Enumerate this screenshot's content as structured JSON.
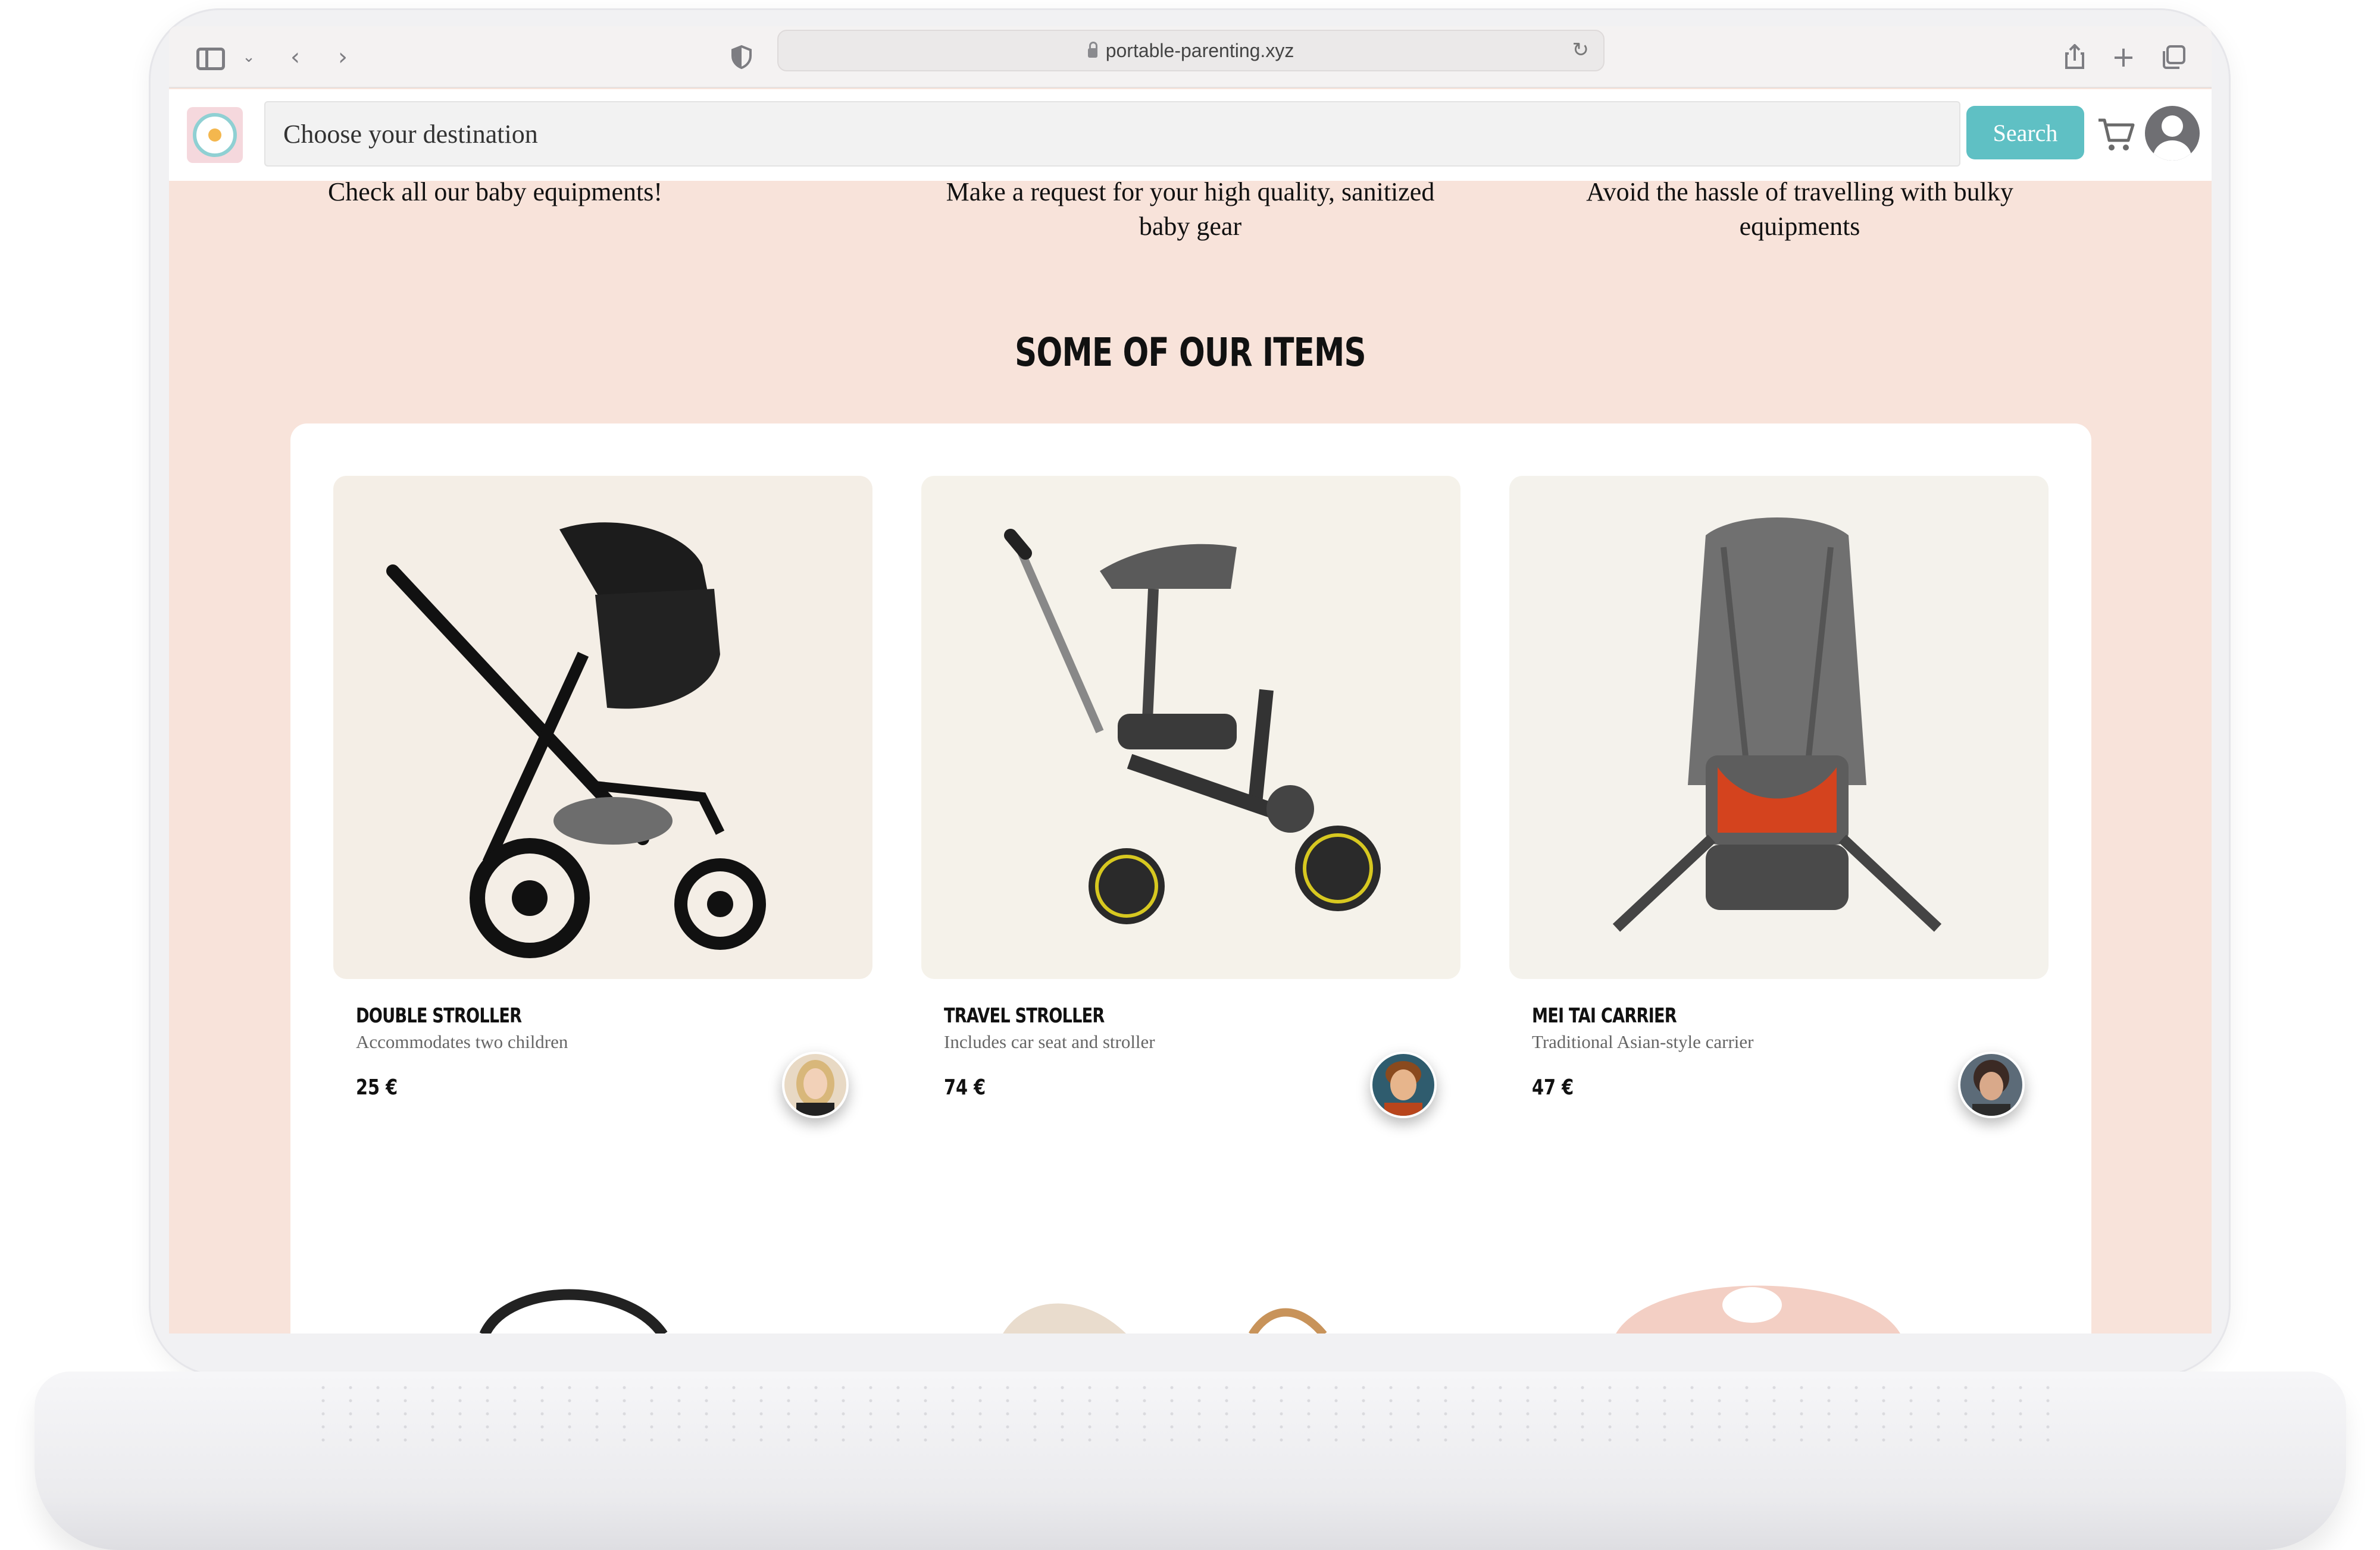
{
  "browser": {
    "url": "portable-parenting.xyz"
  },
  "header": {
    "search_placeholder": "Choose your destination",
    "search_button": "Search"
  },
  "features": [
    {
      "text": "Check all our baby equipments!"
    },
    {
      "text": "Make a request for your high quality, sanitized baby gear"
    },
    {
      "text": "Avoid the hassle of travelling with bulky equipments"
    }
  ],
  "section": {
    "title": "SOME OF OUR ITEMS"
  },
  "items": [
    {
      "title": "DOUBLE STROLLER",
      "description": "Accommodates two children",
      "price": "25 €"
    },
    {
      "title": "TRAVEL STROLLER",
      "description": "Includes car seat and stroller",
      "price": "74 €"
    },
    {
      "title": "MEI TAI CARRIER",
      "description": "Traditional Asian-style carrier",
      "price": "47 €"
    }
  ],
  "colors": {
    "accent": "#5fc0c4",
    "page_background": "#f8e3da"
  }
}
